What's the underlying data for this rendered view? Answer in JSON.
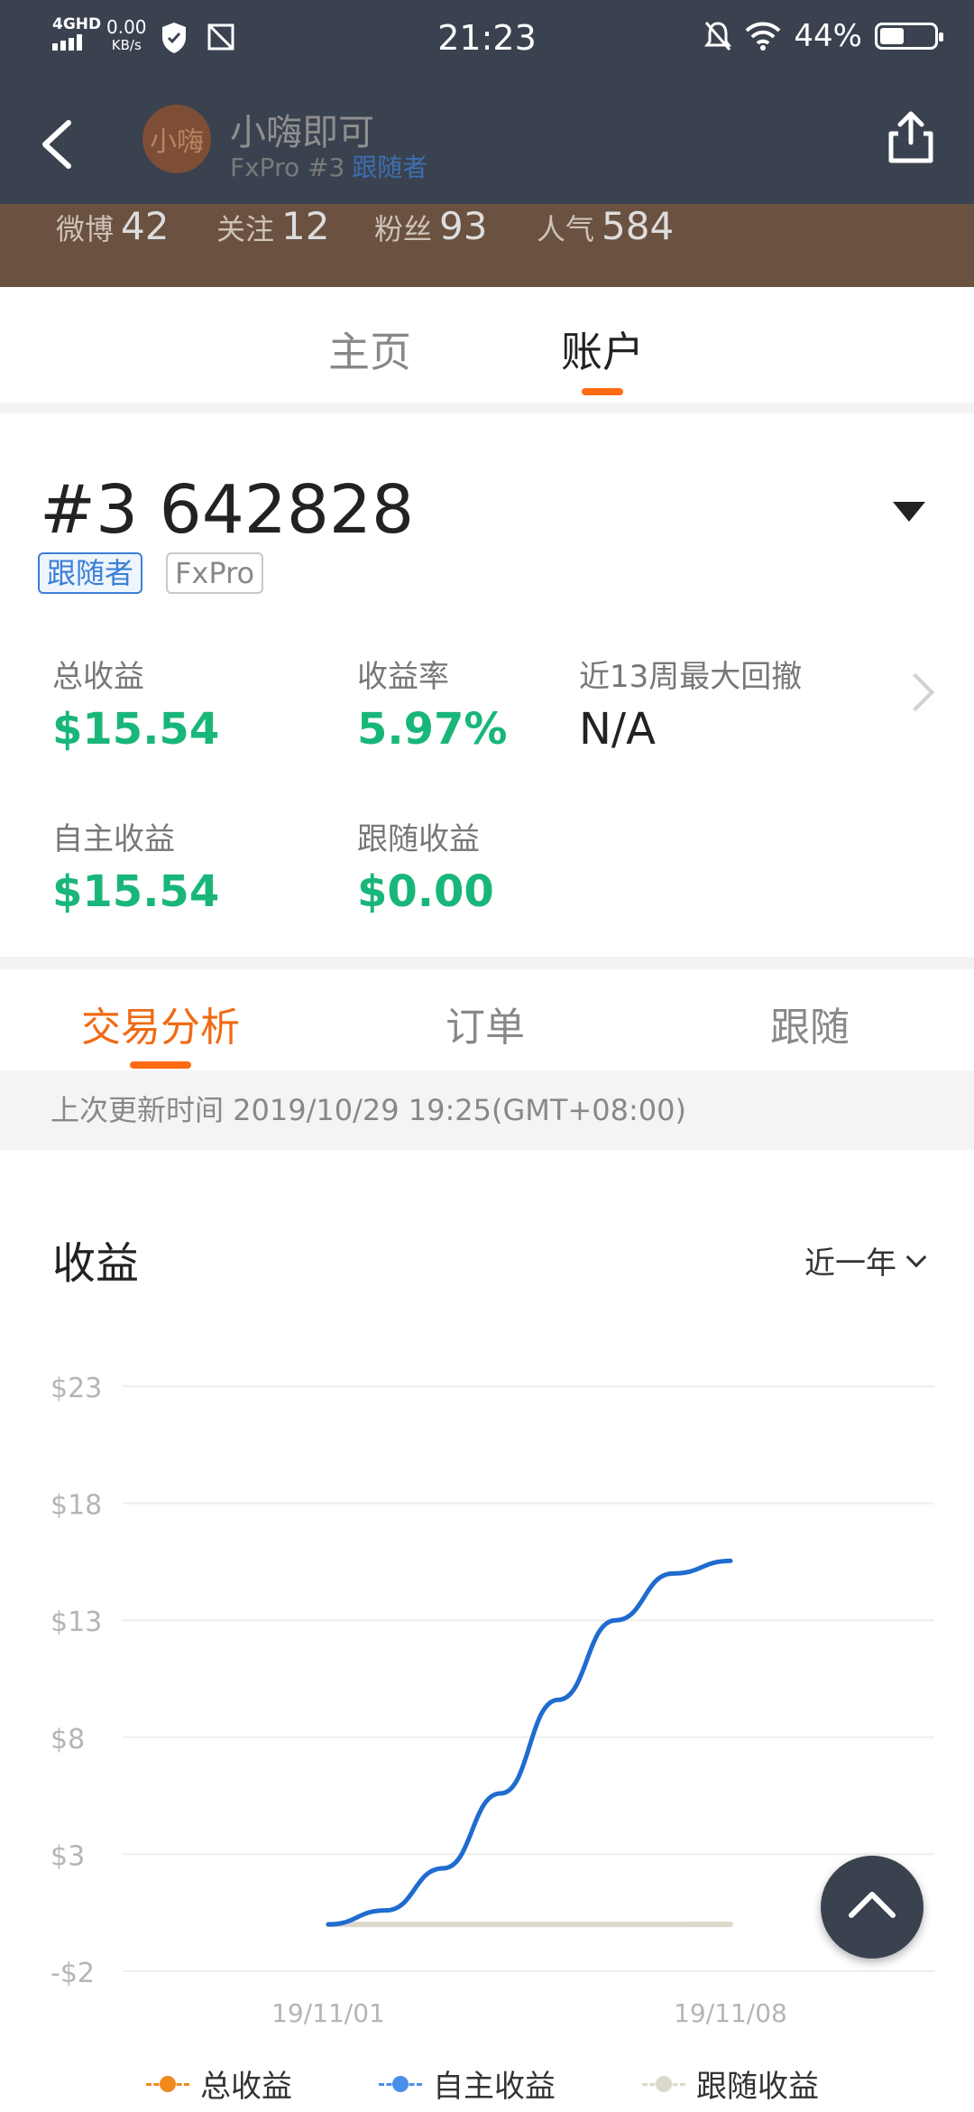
{
  "status_bar": {
    "network_type": "4GHD",
    "speed_value": "0.00",
    "speed_unit": "KB/s",
    "time": "21:23",
    "battery": "44%",
    "battery_level": 0.44
  },
  "header": {
    "avatar_text": "小嗨",
    "name": "小嗨即可",
    "sub_broker": "FxPro #3",
    "sub_role": "跟随者"
  },
  "profile_stats": [
    {
      "label": "微博",
      "value": "42"
    },
    {
      "label": "关注",
      "value": "12"
    },
    {
      "label": "粉丝",
      "value": "93"
    },
    {
      "label": "人气",
      "value": "584"
    }
  ],
  "main_tabs": [
    {
      "label": "主页",
      "active": false
    },
    {
      "label": "账户",
      "active": true
    }
  ],
  "account": {
    "title": "#3 642828",
    "tags": [
      "跟随者",
      "FxPro"
    ]
  },
  "metrics": [
    {
      "label": "总收益",
      "value": "$15.54"
    },
    {
      "label": "收益率",
      "value": "5.97%"
    },
    {
      "label": "近13周最大回撤",
      "value": "N/A"
    },
    {
      "label": "自主收益",
      "value": "$15.54"
    },
    {
      "label": "跟随收益",
      "value": "$0.00"
    }
  ],
  "sub_tabs": [
    {
      "label": "交易分析",
      "active": true
    },
    {
      "label": "订单",
      "active": false
    },
    {
      "label": "跟随",
      "active": false
    }
  ],
  "update_text": "上次更新时间 2019/10/29 19:25(GMT+08:00)",
  "chart_section": {
    "title": "收益",
    "period": "近一年"
  },
  "colors": {
    "header_bg": "#3a4250",
    "accent": "#ff6a13",
    "positive": "#19b67a",
    "total_series": "#f08a1c",
    "self_series": "#4a8fe8",
    "follow_series": "#dcd8cc",
    "line_blue": "#1f6bd0"
  },
  "chart_data": {
    "type": "line",
    "title": "",
    "xlabel": "",
    "ylabel": "",
    "x_ticks": [
      "19/11/01",
      "19/11/08"
    ],
    "y_ticks": [
      "$23",
      "$18",
      "$13",
      "$8",
      "$3",
      "-$2"
    ],
    "ylim": [
      -2,
      23
    ],
    "x": [
      "19/11/01",
      "19/11/02",
      "19/11/03",
      "19/11/04",
      "19/11/05",
      "19/11/06",
      "19/11/07",
      "19/11/08"
    ],
    "series": [
      {
        "name": "自主收益",
        "values": [
          0,
          0.6,
          2.4,
          5.6,
          9.6,
          13.0,
          15.0,
          15.54
        ]
      },
      {
        "name": "跟随收益",
        "values": [
          0,
          0,
          0,
          0,
          0,
          0,
          0,
          0
        ]
      }
    ],
    "legend": [
      "总收益",
      "自主收益",
      "跟随收益"
    ],
    "legend_position": "bottom",
    "grid": true
  }
}
